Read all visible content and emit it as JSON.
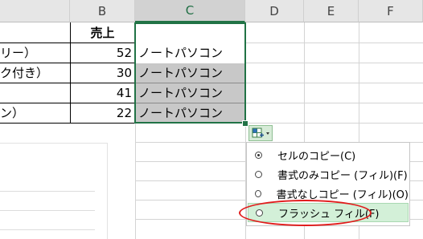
{
  "columns": [
    "B",
    "C",
    "D",
    "E",
    "F"
  ],
  "header_row": {
    "b": "売上",
    "c": ""
  },
  "rows": [
    {
      "a": "リー）",
      "b": "52",
      "c": "ノートパソコン"
    },
    {
      "a": "ク付き）",
      "b": "30",
      "c": "ノートパソコン"
    },
    {
      "a": "",
      "b": "41",
      "c": "ノートパソコン"
    },
    {
      "a": "ン）",
      "b": "22",
      "c": "ノートパソコン"
    }
  ],
  "autofill_menu": {
    "icon": "autofill-options-icon",
    "items": [
      {
        "label": "セルのコピー(C)",
        "selected": true
      },
      {
        "label": "書式のみコピー (フィル)(F)",
        "selected": false
      },
      {
        "label": "書式なしコピー (フィル)(O)",
        "selected": false
      },
      {
        "label": "フラッシュ フィル(F)",
        "selected": false
      }
    ]
  },
  "colors": {
    "accent": "#217346",
    "highlight": "#e11c1c",
    "selected_fill": "#c8c8c8"
  }
}
